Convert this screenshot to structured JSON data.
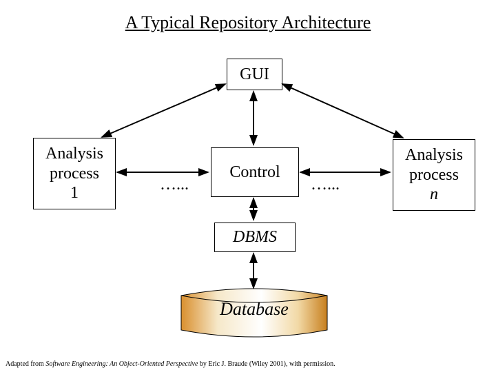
{
  "title": "A Typical Repository Architecture",
  "gui": "GUI",
  "process_left": "Analysis process 1",
  "process_right": "Analysis process n",
  "control": "Control",
  "dbms": "DBMS",
  "database": "Database",
  "ellipsis_left": "…...",
  "ellipsis_right": "…...",
  "credit_prefix": "Adapted from ",
  "credit_title": "Software Engineering: An Object-Oriented Perspective",
  "credit_suffix": " by Eric J. Braude (Wiley 2001), with permission."
}
